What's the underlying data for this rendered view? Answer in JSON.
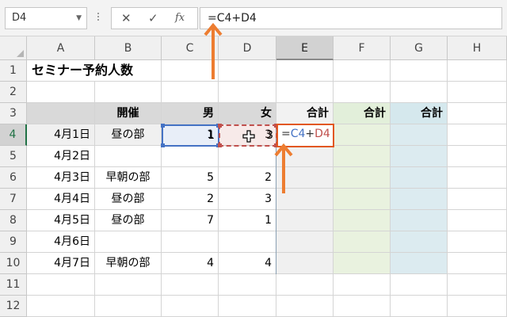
{
  "formula_bar": {
    "name_box": "D4",
    "cancel_glyph": "✕",
    "enter_glyph": "✓",
    "fx_label": "fx",
    "formula": "=C4+D4"
  },
  "columns": [
    "A",
    "B",
    "C",
    "D",
    "E",
    "F",
    "G",
    "H"
  ],
  "rows": [
    "1",
    "2",
    "3",
    "4",
    "5",
    "6",
    "7",
    "8",
    "9",
    "10",
    "11",
    "12"
  ],
  "title": "セミナー予約人数",
  "table_headers": {
    "B": "開催",
    "C": "男",
    "D": "女",
    "E": "合計",
    "F": "合計",
    "G": "合計"
  },
  "data_rows": [
    {
      "date": "4月1日",
      "session": "昼の部",
      "male": "1",
      "female": "3"
    },
    {
      "date": "4月2日",
      "session": "",
      "male": "",
      "female": ""
    },
    {
      "date": "4月3日",
      "session": "早朝の部",
      "male": "5",
      "female": "2"
    },
    {
      "date": "4月4日",
      "session": "昼の部",
      "male": "2",
      "female": "3"
    },
    {
      "date": "4月5日",
      "session": "昼の部",
      "male": "7",
      "female": "1"
    },
    {
      "date": "4月6日",
      "session": "",
      "male": "",
      "female": ""
    },
    {
      "date": "4月7日",
      "session": "早朝の部",
      "male": "4",
      "female": "4"
    }
  ],
  "editing_cell": {
    "address": "E4",
    "tokens": {
      "eq": "=",
      "ref1": "C4",
      "op": "+",
      "ref2": "D4"
    }
  },
  "colors": {
    "accent_arrow": "#ed7d31",
    "ref_blue": "#4472c4",
    "ref_red": "#c0504d",
    "excel_green": "#207245"
  },
  "icons": [
    "cancel-icon",
    "enter-icon",
    "fx-icon",
    "dropdown-icon",
    "arrow-up-icon",
    "move-cursor-icon"
  ]
}
